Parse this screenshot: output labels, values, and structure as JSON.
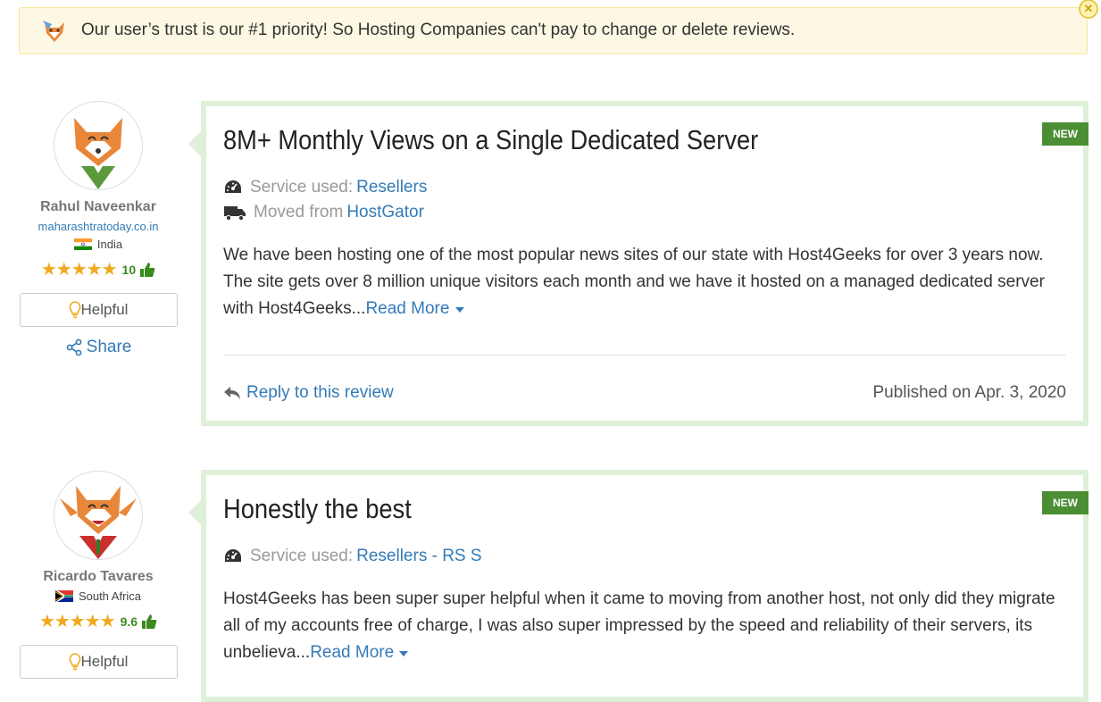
{
  "banner": {
    "text": "Our user’s trust is our #1 priority! So Hosting Companies can't pay to change or delete reviews.",
    "close_icon": "close-icon"
  },
  "reviews": [
    {
      "author": {
        "name": "Rahul Naveenkar",
        "site": "maharashtratoday.co.in",
        "country": "India",
        "stars": "★★★★★",
        "score": "10",
        "helpful_label": "Helpful",
        "share_label": "Share"
      },
      "badge": "NEW",
      "title": "8M+ Monthly Views on a Single Dedicated Server",
      "service_label": "Service used:",
      "service_value": "Resellers",
      "moved_label": "Moved from",
      "moved_value": "HostGator",
      "body": "We have been hosting one of the most popular news sites of our state with Host4Geeks for over 3 years now. The site gets over 8 million unique visitors each month and we have it hosted on a managed dedicated server with Host4Geeks...",
      "read_more": "Read More",
      "reply_label": "Reply to this review",
      "published": "Published on Apr. 3, 2020"
    },
    {
      "author": {
        "name": "Ricardo Tavares",
        "country": "South Africa",
        "stars": "★★★★★",
        "score": "9.6",
        "helpful_label": "Helpful"
      },
      "badge": "NEW",
      "title": "Honestly the best",
      "service_label": "Service used:",
      "service_value": "Resellers - RS S",
      "body": "Host4Geeks has been super super helpful when it came to moving from another host, not only did they migrate all of my accounts free of charge, I was also super impressed by the speed and reliability of their servers, its unbelieva...",
      "read_more": "Read More"
    }
  ],
  "colors": {
    "accent": "#337ab7",
    "badge": "#4b8e34",
    "card_border": "#dff0d8",
    "banner_bg": "#fcf8e3",
    "star": "#f0a81c"
  }
}
